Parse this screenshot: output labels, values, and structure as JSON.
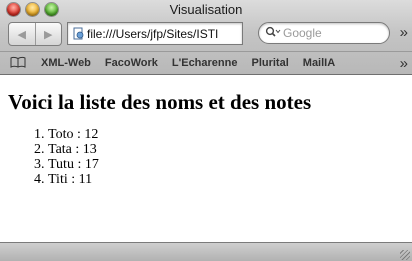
{
  "window": {
    "title": "Visualisation"
  },
  "toolbar": {
    "back_icon": "back-arrow-icon",
    "forward_icon": "forward-arrow-icon",
    "url": "file:///Users/jfp/Sites/ISTI",
    "search_placeholder": "Google",
    "overflow": "»"
  },
  "bookmarks": {
    "items": [
      "XML-Web",
      "FacoWork",
      "L'Echarenne",
      "Plurital",
      "MailIA"
    ],
    "overflow": "»"
  },
  "page": {
    "heading": "Voici la liste des noms et des notes",
    "items": [
      "Toto : 12",
      "Tata : 13",
      "Tutu : 17",
      "Titi : 11"
    ]
  },
  "colors": {
    "close": "#e0342a",
    "minimize": "#f1b22a",
    "zoom": "#58b632"
  }
}
